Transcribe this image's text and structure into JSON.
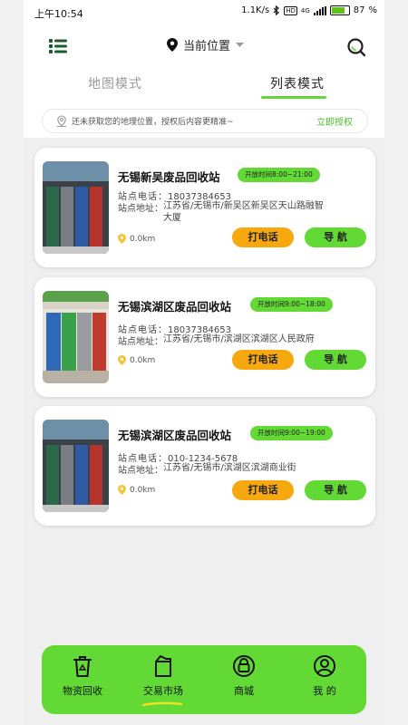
{
  "status_bar": {
    "time": "上午10:54",
    "speed": "1.1K/s",
    "hd": "HD",
    "network": "4G",
    "battery": "87"
  },
  "header": {
    "location": "当前位置"
  },
  "tabs": [
    {
      "label": "地图模式"
    },
    {
      "label": "列表模式"
    }
  ],
  "auth_bar": {
    "message": "还未获取您的地理位置，授权后内容更精准~",
    "button": "立即授权"
  },
  "labels": {
    "phone": "站点电话：",
    "address": "站点地址："
  },
  "stations": [
    {
      "name": "无锡新吴废品回收站",
      "hours": "开放时间8:00~21:00",
      "phone": "18037384653",
      "address": "江苏省/无锡市/新吴区新吴区天山路融智大厦",
      "distance": "0.0km",
      "call": "打电话",
      "navigate": "导 航"
    },
    {
      "name": "无锡滨湖区废品回收站",
      "hours": "开放时间9:00~18:00",
      "phone": "18037384653",
      "address": "江苏省/无锡市/滨湖区滨湖区人民政府",
      "distance": "0.0km",
      "call": "打电话",
      "navigate": "导 航"
    },
    {
      "name": "无锡滨湖区废品回收站",
      "hours": "开放时间9:00~19:00",
      "phone": "010-1234-5678",
      "address": "江苏省/无锡市/滨湖区滨湖商业街",
      "distance": "0.0km",
      "call": "打电话",
      "navigate": "导 航"
    }
  ],
  "bottom_nav": [
    {
      "label": "物资回收",
      "icon": "recycle-bin-icon"
    },
    {
      "label": "交易市场",
      "icon": "trade-market-icon",
      "active": true
    },
    {
      "label": "商城",
      "icon": "mall-icon"
    },
    {
      "label": "我 的",
      "icon": "profile-icon"
    }
  ],
  "colors": {
    "accent": "#62d934",
    "call": "#f7a80f",
    "authText": "#4ec02a"
  }
}
